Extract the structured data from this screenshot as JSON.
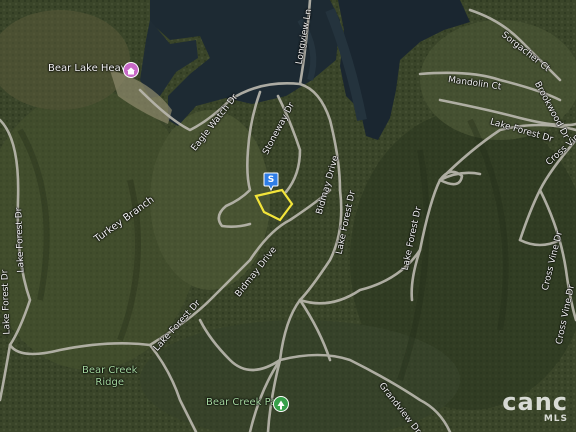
{
  "map": {
    "marker_label": "S",
    "places": {
      "bear_lake_heaven": "Bear Lake Heaven",
      "bear_creek_park": "Bear Creek Park",
      "bear_creek_ridge": "Bear Creek\nRidge",
      "turkey_branch": "Turkey Branch"
    },
    "roads": {
      "longview_ln": "Longview Ln",
      "sorgacher_ct": "Sorgacher Ct",
      "mandolin_ct": "Mandolin Ct",
      "brookwood_dr": "Brookwood Dr",
      "lake_forest_dr_ne": "Lake Forest Dr",
      "cross_vine_ne": "Cross Vine D",
      "eagle_watch_dr": "Eagle Watch Dr",
      "stoneway_dr": "Stoneway Dr",
      "bidmay_drive_n": "Bidmay Drive",
      "lake_forest_dr_w": "Lake Forest Dr",
      "lake_forest_dr_mid": "Lake Forest Dr",
      "lake_forest_dr_c": "Lake Forest Dr",
      "lake_forest_dr_e": "Lake Forest Dr",
      "cross_vine_dr": "Cross Vine Dr",
      "cross_vine_dr_se": "Cross Vine Dr",
      "lake_forest_dr_sw": "Lake Forest Dr",
      "bidmay_drive_s": "Bidmay Drive",
      "grandview_dr": "Grandview Dr"
    },
    "brand": {
      "logo": "canc",
      "sub": "MLS"
    }
  }
}
